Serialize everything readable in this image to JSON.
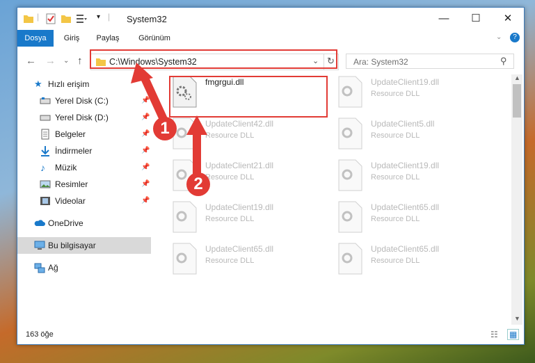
{
  "window": {
    "title": "System32",
    "controls": {
      "minimize": "—",
      "maximize": "☐",
      "close": "✕"
    }
  },
  "ribbon": {
    "tabs": [
      "Dosya",
      "Giriş",
      "Paylaş",
      "Görünüm"
    ],
    "help": "?"
  },
  "address": {
    "path": "C:\\Windows\\System32",
    "search_placeholder": "Ara: System32"
  },
  "nav": {
    "quick_access": "Hızlı erişim",
    "items": [
      {
        "label": "Yerel Disk (C:)",
        "icon": "drive-icon"
      },
      {
        "label": "Yerel Disk (D:)",
        "icon": "drive-icon"
      },
      {
        "label": "Belgeler",
        "icon": "documents-icon"
      },
      {
        "label": "İndirmeler",
        "icon": "download-icon"
      },
      {
        "label": "Müzik",
        "icon": "music-icon"
      },
      {
        "label": "Resimler",
        "icon": "pictures-icon"
      },
      {
        "label": "Videolar",
        "icon": "videos-icon"
      }
    ],
    "onedrive": "OneDrive",
    "this_pc": "Bu bilgisayar",
    "network": "Ağ"
  },
  "files": [
    {
      "name": "fmgrgui.dll",
      "type": ""
    },
    {
      "name": "UpdateClient19.dll",
      "type": "Resource DLL"
    },
    {
      "name": "UpdateClient42.dll",
      "type": "Resource DLL"
    },
    {
      "name": "UpdateClient5.dll",
      "type": "Resource DLL"
    },
    {
      "name": "UpdateClient21.dll",
      "type": "Resource DLL"
    },
    {
      "name": "UpdateClient19.dll",
      "type": "Resource DLL"
    },
    {
      "name": "UpdateClient19.dll",
      "type": "Resource DLL"
    },
    {
      "name": "UpdateClient65.dll",
      "type": "Resource DLL"
    },
    {
      "name": "UpdateClient65.dll",
      "type": "Resource DLL"
    },
    {
      "name": "UpdateClient65.dll",
      "type": "Resource DLL"
    }
  ],
  "status": {
    "count": "163 öğe"
  },
  "annotations": {
    "step1": "1",
    "step2": "2",
    "color": "#e23b35"
  },
  "colors": {
    "accent": "#1979ca",
    "selected": "#cce8ff"
  }
}
